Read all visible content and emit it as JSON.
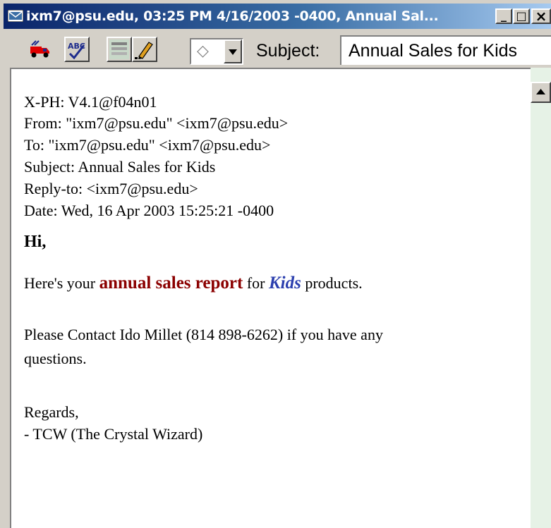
{
  "window": {
    "title": "ixm7@psu.edu, 03:25 PM 4/16/2003 -0400, Annual Sal...",
    "minimize_label": "_",
    "maximize_label": "□",
    "close_label": "×"
  },
  "toolbar": {
    "priority_value": "◇",
    "subject_label": "Subject:",
    "subject_value": "Annual Sales for Kids"
  },
  "headers": [
    "X-PH: V4.1@f04n01",
    "From: \"ixm7@psu.edu\" <ixm7@psu.edu>",
    "To: \"ixm7@psu.edu\" <ixm7@psu.edu>",
    "Subject: Annual Sales for Kids",
    "Reply-to: <ixm7@psu.edu>",
    "Date: Wed, 16 Apr 2003 15:25:21 -0400"
  ],
  "message": {
    "greeting": "Hi,",
    "line1_prefix": "Here's your ",
    "line1_highlight1": "annual sales report",
    "line1_middle": " for ",
    "line1_highlight2": "Kids",
    "line1_suffix": " products.",
    "line2a": "Please Contact Ido Millet (814 898-6262) if you have any",
    "line2b": "questions.",
    "closing": "Regards,",
    "signature": "- TCW (The Crystal Wizard)"
  },
  "icons": [
    "mail-window-icon",
    "truck-icon",
    "spell-check-icon",
    "blah-icon",
    "pencil-icon",
    "scroll-up-arrow-icon"
  ]
}
